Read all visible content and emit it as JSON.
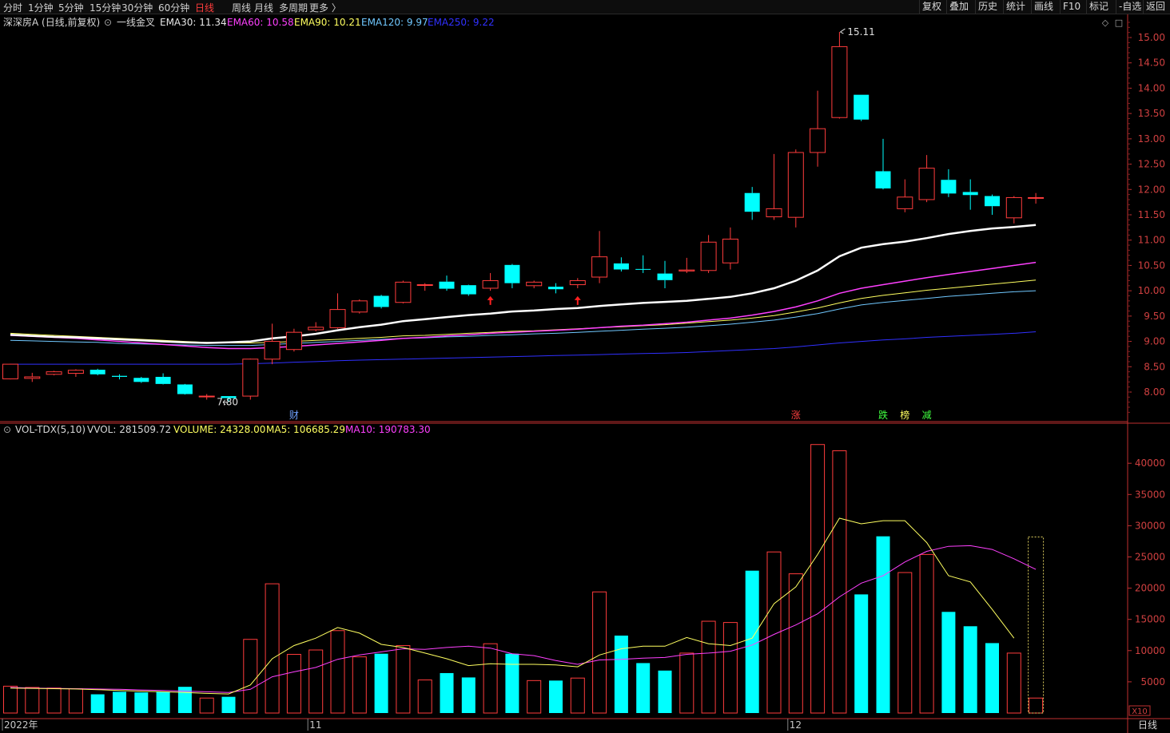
{
  "toolbar": {
    "periods": [
      "分时",
      "1分钟",
      "5分钟",
      "15分钟",
      "30分钟",
      "60分钟",
      "日线",
      "周线",
      "月线",
      "多周期",
      "更多 〉"
    ],
    "active_period": "日线",
    "right_buttons": [
      "复权",
      "叠加",
      "历史",
      "统计",
      "画线",
      "F10",
      "标记",
      "-自选",
      "返回"
    ]
  },
  "price_legend": {
    "name": "深深房A (日线,前复权)",
    "indicator": "一线金叉",
    "ema30": "EMA30: 11.34",
    "ema60": "EMA60: 10.58",
    "ema90": "EMA90: 10.21",
    "ema120": "EMA120: 9.97",
    "ema250": "EMA250: 9.22"
  },
  "vol_legend": {
    "name": "VOL-TDX(5,10)",
    "vvol": "VVOL: 281509.72",
    "volume": "VOLUME: 24328.00",
    "ma5": "MA5: 106685.29",
    "ma10": "MA10: 190783.30"
  },
  "colors": {
    "up": "#ff3c3c",
    "down": "#00ffff",
    "ema30": "#ffffff",
    "ema60": "#ff40ff",
    "ema90": "#ffff60",
    "ema120": "#70c8ff",
    "ema250": "#3030ff",
    "ma5": "#ffff60",
    "ma10": "#ff40ff",
    "axis": "#c03030"
  },
  "annotations": {
    "high": "15.11",
    "low": "7.80",
    "markers": [
      {
        "label": "财",
        "index": 13,
        "color": "#6fa0ff"
      },
      {
        "label": "涨",
        "index": 36,
        "color": "#ff4040"
      },
      {
        "label": "跌",
        "index": 40,
        "color": "#40ff40"
      },
      {
        "label": "榜",
        "index": 41,
        "color": "#ffff60"
      },
      {
        "label": "减",
        "index": 42,
        "color": "#40ff40"
      }
    ],
    "arrows": [
      22,
      26
    ]
  },
  "x_labels": [
    {
      "text": "2022年",
      "index": 0
    },
    {
      "text": "11",
      "index": 14
    },
    {
      "text": "12",
      "index": 36
    }
  ],
  "period_label": "日线",
  "vol_unit": "X10",
  "chart_data": {
    "type": "candlestick",
    "price_axis": {
      "min": 7.55,
      "max": 15.3,
      "ticks": [
        "15.00",
        "14.50",
        "14.00",
        "13.50",
        "13.00",
        "12.50",
        "12.00",
        "11.50",
        "11.00",
        "10.50",
        "10.00",
        "9.50",
        "9.00",
        "8.50",
        "8.00"
      ]
    },
    "volume_axis": {
      "max": 44500,
      "ticks": [
        "40000",
        "35000",
        "30000",
        "25000",
        "20000",
        "15000",
        "10000",
        "5000"
      ]
    },
    "candles": [
      [
        8.26,
        8.55,
        8.25,
        8.56
      ],
      [
        8.27,
        8.3,
        8.2,
        8.38
      ],
      [
        8.35,
        8.4,
        8.33,
        8.42
      ],
      [
        8.37,
        8.43,
        8.3,
        8.45
      ],
      [
        8.44,
        8.35,
        8.33,
        8.46
      ],
      [
        8.32,
        8.3,
        8.25,
        8.35
      ],
      [
        8.28,
        8.2,
        8.18,
        8.3
      ],
      [
        8.3,
        8.16,
        8.15,
        8.37
      ],
      [
        8.15,
        7.96,
        7.95,
        8.16
      ],
      [
        7.92,
        7.92,
        7.85,
        7.96
      ],
      [
        7.92,
        7.88,
        7.8,
        7.92
      ],
      [
        7.92,
        8.65,
        7.85,
        8.66
      ],
      [
        8.65,
        9.0,
        8.55,
        9.35
      ],
      [
        8.84,
        9.18,
        8.8,
        9.25
      ],
      [
        9.23,
        9.28,
        9.2,
        9.38
      ],
      [
        9.27,
        9.63,
        9.25,
        9.95
      ],
      [
        9.58,
        9.8,
        9.55,
        9.83
      ],
      [
        9.9,
        9.68,
        9.65,
        9.92
      ],
      [
        9.77,
        10.17,
        9.75,
        10.2
      ],
      [
        10.12,
        10.12,
        10.0,
        10.15
      ],
      [
        10.18,
        10.04,
        10.0,
        10.3
      ],
      [
        10.11,
        9.93,
        9.9,
        10.12
      ],
      [
        10.05,
        10.2,
        10.0,
        10.35
      ],
      [
        10.51,
        10.15,
        10.05,
        10.53
      ],
      [
        10.1,
        10.17,
        10.05,
        10.2
      ],
      [
        10.08,
        10.03,
        9.95,
        10.15
      ],
      [
        10.12,
        10.2,
        10.05,
        10.25
      ],
      [
        10.27,
        10.67,
        10.15,
        11.18
      ],
      [
        10.54,
        10.42,
        10.38,
        10.66
      ],
      [
        10.43,
        10.42,
        10.35,
        10.7
      ],
      [
        10.34,
        10.21,
        10.05,
        10.59
      ],
      [
        10.39,
        10.41,
        10.35,
        10.65
      ],
      [
        10.4,
        10.96,
        10.35,
        11.1
      ],
      [
        10.55,
        11.02,
        10.42,
        11.25
      ],
      [
        11.93,
        11.56,
        11.4,
        12.05
      ],
      [
        11.46,
        11.62,
        11.4,
        12.7
      ],
      [
        11.45,
        12.73,
        11.25,
        12.79
      ],
      [
        12.73,
        13.2,
        12.45,
        13.95
      ],
      [
        13.42,
        14.82,
        13.4,
        15.11
      ],
      [
        13.87,
        13.38,
        13.35,
        13.87
      ],
      [
        12.36,
        12.02,
        12.0,
        13.0
      ],
      [
        11.62,
        11.85,
        11.55,
        12.2
      ],
      [
        11.8,
        12.42,
        11.75,
        12.68
      ],
      [
        12.19,
        11.92,
        11.85,
        12.4
      ],
      [
        11.95,
        11.89,
        11.6,
        12.2
      ],
      [
        11.87,
        11.67,
        11.5,
        11.9
      ],
      [
        11.44,
        11.84,
        11.33,
        11.87
      ],
      [
        11.84,
        11.84,
        11.72,
        11.93
      ]
    ],
    "volume": [
      4300,
      4100,
      4000,
      3900,
      3000,
      3400,
      3300,
      3400,
      4200,
      2400,
      2600,
      11800,
      20700,
      9400,
      10100,
      13200,
      9000,
      9500,
      10800,
      5300,
      6400,
      5700,
      11100,
      9500,
      5200,
      5200,
      5600,
      19400,
      12400,
      8000,
      6800,
      9600,
      14700,
      14500,
      22800,
      25800,
      22300,
      43000,
      42000,
      19000,
      28300,
      22500,
      25400,
      16200,
      13900,
      11200,
      9600,
      2400
    ],
    "ema30": [
      9.13,
      9.11,
      9.09,
      9.08,
      9.06,
      9.04,
      9.02,
      9.0,
      8.98,
      8.97,
      8.98,
      9.0,
      9.06,
      9.1,
      9.15,
      9.22,
      9.28,
      9.33,
      9.4,
      9.44,
      9.48,
      9.52,
      9.55,
      9.59,
      9.61,
      9.64,
      9.66,
      9.7,
      9.73,
      9.76,
      9.78,
      9.8,
      9.84,
      9.88,
      9.95,
      10.05,
      10.2,
      10.4,
      10.68,
      10.85,
      10.92,
      10.97,
      11.04,
      11.12,
      11.18,
      11.23,
      11.26,
      11.3
    ],
    "ema60": [
      9.12,
      9.1,
      9.08,
      9.06,
      9.03,
      9.0,
      8.97,
      8.94,
      8.91,
      8.88,
      8.86,
      8.86,
      8.88,
      8.9,
      8.93,
      8.96,
      8.99,
      9.02,
      9.06,
      9.08,
      9.11,
      9.13,
      9.16,
      9.18,
      9.2,
      9.22,
      9.24,
      9.27,
      9.3,
      9.32,
      9.35,
      9.38,
      9.42,
      9.46,
      9.52,
      9.59,
      9.68,
      9.8,
      9.95,
      10.05,
      10.12,
      10.19,
      10.26,
      10.32,
      10.38,
      10.44,
      10.5,
      10.56
    ],
    "ema90": [
      9.16,
      9.14,
      9.12,
      9.1,
      9.08,
      9.06,
      9.04,
      9.02,
      9.0,
      8.98,
      8.97,
      8.97,
      8.98,
      9.0,
      9.02,
      9.04,
      9.06,
      9.08,
      9.11,
      9.12,
      9.14,
      9.16,
      9.18,
      9.2,
      9.21,
      9.23,
      9.25,
      9.27,
      9.29,
      9.31,
      9.33,
      9.36,
      9.39,
      9.42,
      9.46,
      9.51,
      9.58,
      9.66,
      9.76,
      9.85,
      9.91,
      9.96,
      10.01,
      10.05,
      10.09,
      10.13,
      10.17,
      10.21
    ],
    "ema120": [
      9.02,
      9.01,
      9.0,
      8.99,
      8.98,
      8.96,
      8.95,
      8.94,
      8.93,
      8.92,
      8.92,
      8.92,
      8.94,
      8.96,
      8.98,
      9.0,
      9.02,
      9.04,
      9.06,
      9.07,
      9.09,
      9.1,
      9.12,
      9.13,
      9.15,
      9.16,
      9.18,
      9.2,
      9.22,
      9.24,
      9.26,
      9.28,
      9.31,
      9.34,
      9.38,
      9.42,
      9.48,
      9.55,
      9.64,
      9.72,
      9.77,
      9.81,
      9.85,
      9.89,
      9.92,
      9.95,
      9.98,
      10.0
    ],
    "ema250": [
      8.55,
      8.55,
      8.55,
      8.55,
      8.55,
      8.55,
      8.55,
      8.55,
      8.55,
      8.55,
      8.55,
      8.56,
      8.57,
      8.59,
      8.6,
      8.62,
      8.63,
      8.64,
      8.65,
      8.66,
      8.67,
      8.68,
      8.69,
      8.7,
      8.71,
      8.72,
      8.73,
      8.74,
      8.75,
      8.76,
      8.77,
      8.78,
      8.8,
      8.82,
      8.84,
      8.86,
      8.89,
      8.93,
      8.97,
      9.0,
      9.03,
      9.05,
      9.08,
      9.1,
      9.12,
      9.14,
      9.16,
      9.19
    ],
    "ma5": [
      4000,
      3950,
      3900,
      3850,
      3750,
      3600,
      3500,
      3400,
      3300,
      3150,
      3050,
      4500,
      8700,
      10800,
      12000,
      13700,
      12800,
      11000,
      10500,
      9600,
      8700,
      7600,
      7900,
      7800,
      7800,
      7700,
      7400,
      9300,
      10300,
      10700,
      10700,
      12100,
      11100,
      10800,
      12000,
      17500,
      20200,
      25400,
      31200,
      30300,
      30800,
      30800,
      27300,
      22000,
      21000,
      16600,
      12000
    ],
    "ma10": [
      4100,
      4000,
      3950,
      3900,
      3850,
      3800,
      3700,
      3600,
      3500,
      3400,
      3300,
      3800,
      5800,
      6600,
      7300,
      8600,
      9300,
      9800,
      10300,
      10200,
      10500,
      10700,
      10400,
      9500,
      9200,
      8400,
      7800,
      8500,
      8600,
      8800,
      8900,
      9400,
      9600,
      9900,
      10900,
      12600,
      14100,
      15900,
      18600,
      20800,
      22000,
      24200,
      25900,
      26700,
      26800,
      26200,
      24700,
      23000
    ]
  }
}
